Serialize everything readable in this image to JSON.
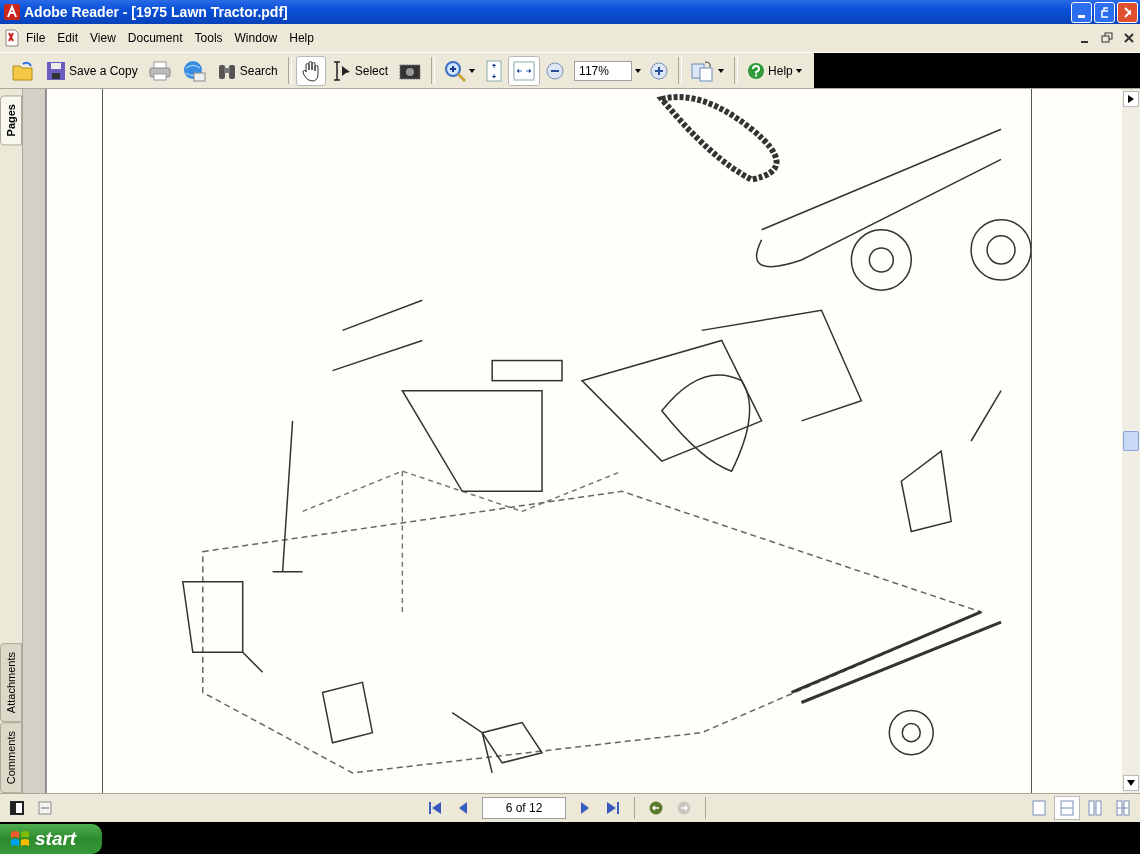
{
  "window": {
    "title": "Adobe Reader - [1975 Lawn Tractor.pdf]"
  },
  "menu": [
    "File",
    "Edit",
    "View",
    "Document",
    "Tools",
    "Window",
    "Help"
  ],
  "toolbar": [
    {
      "kind": "open"
    },
    {
      "kind": "save",
      "label": "Save a Copy"
    },
    {
      "kind": "print"
    },
    {
      "kind": "email"
    },
    {
      "kind": "search",
      "label": "Search"
    },
    {
      "kind": "sep"
    },
    {
      "kind": "hand",
      "selected": true
    },
    {
      "kind": "select",
      "label": "Select",
      "selected": false
    },
    {
      "kind": "snapshot",
      "selected": false
    },
    {
      "kind": "sep"
    },
    {
      "kind": "zoomtool"
    },
    {
      "kind": "fitpage",
      "selected": false
    },
    {
      "kind": "fitwidth",
      "selected": true
    },
    {
      "kind": "zoomout"
    },
    {
      "kind": "zoomfield",
      "value": "117%"
    },
    {
      "kind": "zoomin"
    },
    {
      "kind": "sep"
    },
    {
      "kind": "pages"
    },
    {
      "kind": "sep"
    },
    {
      "kind": "help",
      "label": "Help"
    }
  ],
  "nav_tabs": [
    {
      "label": "Pages",
      "selected": true
    },
    {
      "label": "Attachments",
      "selected": false
    },
    {
      "label": "Comments",
      "selected": false
    }
  ],
  "status_bar": {
    "page_field": "6 of 12",
    "layouts": [
      {
        "selected": false
      },
      {
        "selected": true
      },
      {
        "selected": false
      },
      {
        "selected": false
      }
    ]
  },
  "taskbar": {
    "start": "start"
  }
}
